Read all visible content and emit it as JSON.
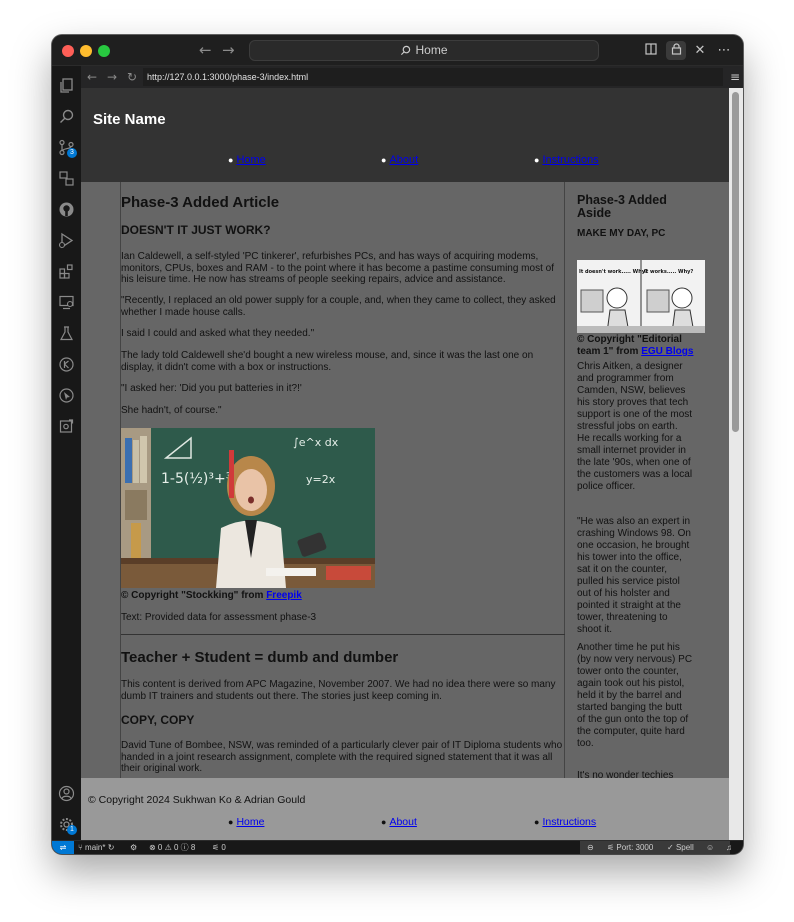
{
  "window": {
    "command_center": "Home"
  },
  "url_bar": {
    "url": "http://127.0.0.1:3000/phase-3/index.html"
  },
  "activity_bar": {
    "source_control_badge": "3",
    "settings_badge": "1"
  },
  "site": {
    "name": "Site Name",
    "nav": [
      "Home",
      "About",
      "Instructions"
    ]
  },
  "article1": {
    "title": "Phase-3 Added Article",
    "heading": "DOESN'T IT JUST WORK?",
    "paragraphs": [
      "Ian Caldewell, a self-styled 'PC tinkerer', refurbishes PCs, and has ways of acquiring modems, monitors, CPUs, boxes and RAM - to the point where it has become a pastime consuming most of his leisure time. He now has streams of people seeking repairs, advice and assistance.",
      "\"Recently, I replaced an old power supply for a couple, and, when they came to collect, they asked whether I made house calls.",
      "I said I could and asked what they needed.\"",
      "The lady told Caldewell she'd bought a new wireless mouse, and, since it was the last one on display, it didn't come with a box or instructions.",
      "\"I asked her: 'Did you put batteries in it?!'",
      "She hadn't, of course.\""
    ],
    "caption_prefix": "© Copyright \"Stockking\" from ",
    "caption_link": "Freepik",
    "source_text": "Text: Provided data for assessment phase-3"
  },
  "article2": {
    "title": "Teacher + Student = dumb and dumber",
    "intro": "This content is derived from APC Magazine, November 2007. We had no idea there were so many dumb IT trainers and students out there. The stories just keep coming in.",
    "heading": "COPY, COPY",
    "paragraph": "David Tune of Bombee, NSW, was reminded of a particularly clever pair of IT Diploma students who handed in a joint research assignment, complete with the required signed statement that it was all their original work."
  },
  "aside": {
    "title": "Phase-3 Added Aside",
    "heading": "MAKE MY DAY, PC",
    "meme_left": "It doesn't work..... Why?",
    "meme_right": "It works..... Why?",
    "caption_prefix": "© Copyright \"Editorial team 1\" from ",
    "caption_link": "EGU Blogs",
    "paragraphs": [
      "Chris Aitken, a designer and programmer from Camden, NSW, believes his story proves that tech support is one of the most stressful jobs on earth. He recalls working for a small internet provider in the late '90s, when one of the customers was a local police officer.",
      "\"He was also an expert in crashing Windows 98. On one occasion, he brought his tower into the office, sat it on the counter, pulled his service pistol out of his holster and pointed it straight at the tower, threatening to shoot it.",
      "Another time he put his (by now very nervous) PC tower onto the counter, again took out his pistol, held it by the barrel and started banging the butt of the gun onto the top of the computer, quite hard too.",
      "It's no wonder techies"
    ]
  },
  "footer": {
    "copyright": "© Copyright 2024 Sukhwan Ko & Adrian Gould",
    "nav": [
      "Home",
      "About",
      "Instructions"
    ]
  },
  "status_bar": {
    "branch": "main*",
    "problems": "⊗ 0 ⚠ 0 ⓘ 8",
    "ports_count": "0",
    "port": "Port: 3000",
    "spell": "Spell"
  },
  "colors": {
    "page_bg": "#666666",
    "header_bg": "#333333",
    "footer_bg": "#999999",
    "link": "#0000ee",
    "accent": "#0078d4"
  }
}
